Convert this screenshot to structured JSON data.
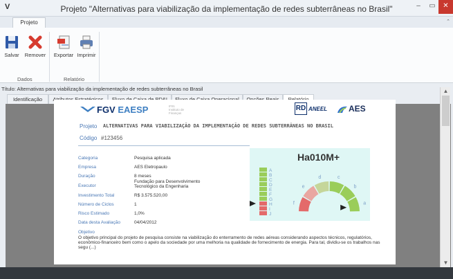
{
  "window": {
    "logo": "V",
    "title": "Projeto \"Alternativas para viabilização da implementação de redes subterrâneas no Brasil\"",
    "min": "–",
    "max": "▭",
    "close": "✕"
  },
  "ribbon": {
    "tab": "Projeto",
    "collapse": "⌃",
    "buttons": {
      "save": "Salvar",
      "remove": "Remover",
      "export": "Exportar",
      "print": "Imprimir"
    },
    "groups": {
      "data": "Dados",
      "report": "Relatório"
    }
  },
  "doc_path": "Título: Alternativas para viabilização da implementação de redes subterrâneas no Brasil",
  "tabs": [
    "Identificação",
    "Atributos Estratégicos",
    "Fluxo de Caixa de PD&I",
    "Fluxo de Caixa Operacional",
    "Opções Reais",
    "Relatório"
  ],
  "report": {
    "logos": {
      "fgv": "FGV",
      "eaesp": " EAESP",
      "ifin": "IFIN\nInstituto de\nFinanças",
      "rd": "RD",
      "aneel": "ANEEL",
      "aes": "AES"
    },
    "project_label": "Projeto",
    "project_title": "ALTERNATIVAS PARA VIABILIZAÇÃO DA IMPLEMENTAÇÃO DE REDES SUBTERRÂNEAS NO BRASIL",
    "code_label": "Código",
    "code": "#123456",
    "fields": [
      {
        "label": "Categoria",
        "value": "Pesquisa aplicada"
      },
      {
        "label": "Empresa",
        "value": "AES Eletropaulo"
      },
      {
        "label": "Duração",
        "value": "8 meses"
      },
      {
        "label": "Executor",
        "value": "Fundação para Desenvolvimento\nTecnológico da Engenharia"
      },
      {
        "label": "Investimento Total",
        "value": "R$ 3.575.520,00"
      },
      {
        "label": "Número de Ciclos",
        "value": "1"
      },
      {
        "label": "Risco Estimado",
        "value": "1,0%"
      },
      {
        "label": "Data desta Avaliação",
        "value": "04/04/2012"
      }
    ],
    "risk_code": "Ha010M+",
    "scale_letters": [
      "A",
      "B",
      "C",
      "D",
      "E",
      "F",
      "G",
      "H",
      "I",
      "J"
    ],
    "scale_colors": [
      "#9acd5a",
      "#9acd5a",
      "#9acd5a",
      "#9acd5a",
      "#9acd5a",
      "#9acd5a",
      "#9acd5a",
      "#e46a6a",
      "#e46a6a",
      "#e46a6a"
    ],
    "scale_marker_level": "H",
    "gauge_letters": [
      "f",
      "e",
      "d",
      "c",
      "b",
      "a"
    ],
    "gauge_colors": [
      "#e46a6a",
      "#e9a7a1",
      "#c5d69a",
      "#9acd5a",
      "#9acd5a",
      "#9acd5a"
    ],
    "gauge_marker": "a",
    "objective_label": "Objetivo",
    "objective_text": "O objetivo principal do projeto de pesquisa consiste na viabilização do enterramento de redes aéreas considerando aspectos técnicos, regulatórios, econômico-financeiro bem como o apelo da sociedade por uma melhoria na qualidade de fornecimento de energia. Para tal, dividiu-se os trabalhos nas segu (...)"
  },
  "scrollbar": {
    "up": "▲",
    "down": "▼"
  }
}
